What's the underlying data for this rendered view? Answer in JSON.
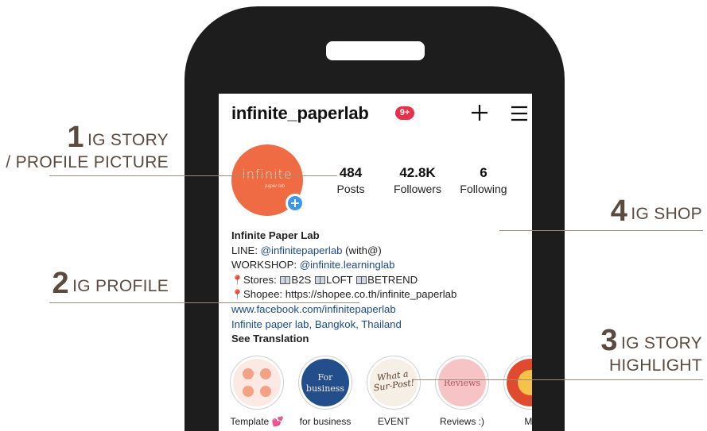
{
  "profile": {
    "username": "infinite_paperlab",
    "notification_badge": "9+",
    "avatar_text": "infinite",
    "avatar_subtext": "paper lab",
    "stats": [
      {
        "value": "484",
        "label": "Posts"
      },
      {
        "value": "42.8K",
        "label": "Followers"
      },
      {
        "value": "6",
        "label": "Following"
      }
    ],
    "bio": {
      "name": "Infinite Paper Lab",
      "line_prefix": "LINE: ",
      "line_handle": "@infinitepaperlab",
      "line_suffix": " (with@)",
      "workshop_prefix": "WORKSHOP: ",
      "workshop_handle": "@infinite.learninglab",
      "stores_prefix": "Stores: ",
      "stores": [
        "B2S",
        "LOFT",
        "BETREND"
      ],
      "shopee": "Shopee: https://shopee.co.th/infinite_paperlab",
      "website": "www.facebook.com/infinitepaperlab",
      "location": "Infinite paper lab, Bangkok, Thailand",
      "translate": "See Translation"
    },
    "highlights": [
      {
        "label": "Template 💕",
        "art": "template"
      },
      {
        "label": "for business",
        "art_text": "For business"
      },
      {
        "label": "EVENT",
        "art_text": "What a Sur-Post!"
      },
      {
        "label": "Reviews :)",
        "art_text": "Reviews"
      },
      {
        "label": "Mil"
      }
    ]
  },
  "callouts": [
    {
      "number": "1",
      "text": "IG STORY",
      "text2": "/ PROFILE PICTURE"
    },
    {
      "number": "2",
      "text": "IG PROFILE"
    },
    {
      "number": "3",
      "text": "IG  STORY",
      "text2": "HIGHLIGHT"
    },
    {
      "number": "4",
      "text": "IG SHOP"
    }
  ],
  "colors": {
    "phone": "#1d1d1d",
    "avatar": "#ee6b43",
    "badge": "#e8304a",
    "link": "#1b4a8a",
    "callout": "#5b4a40",
    "leader": "#a08a7a"
  },
  "icons": [
    "plus-icon",
    "menu-icon",
    "add-story-icon",
    "pin-icon",
    "book-icon"
  ]
}
